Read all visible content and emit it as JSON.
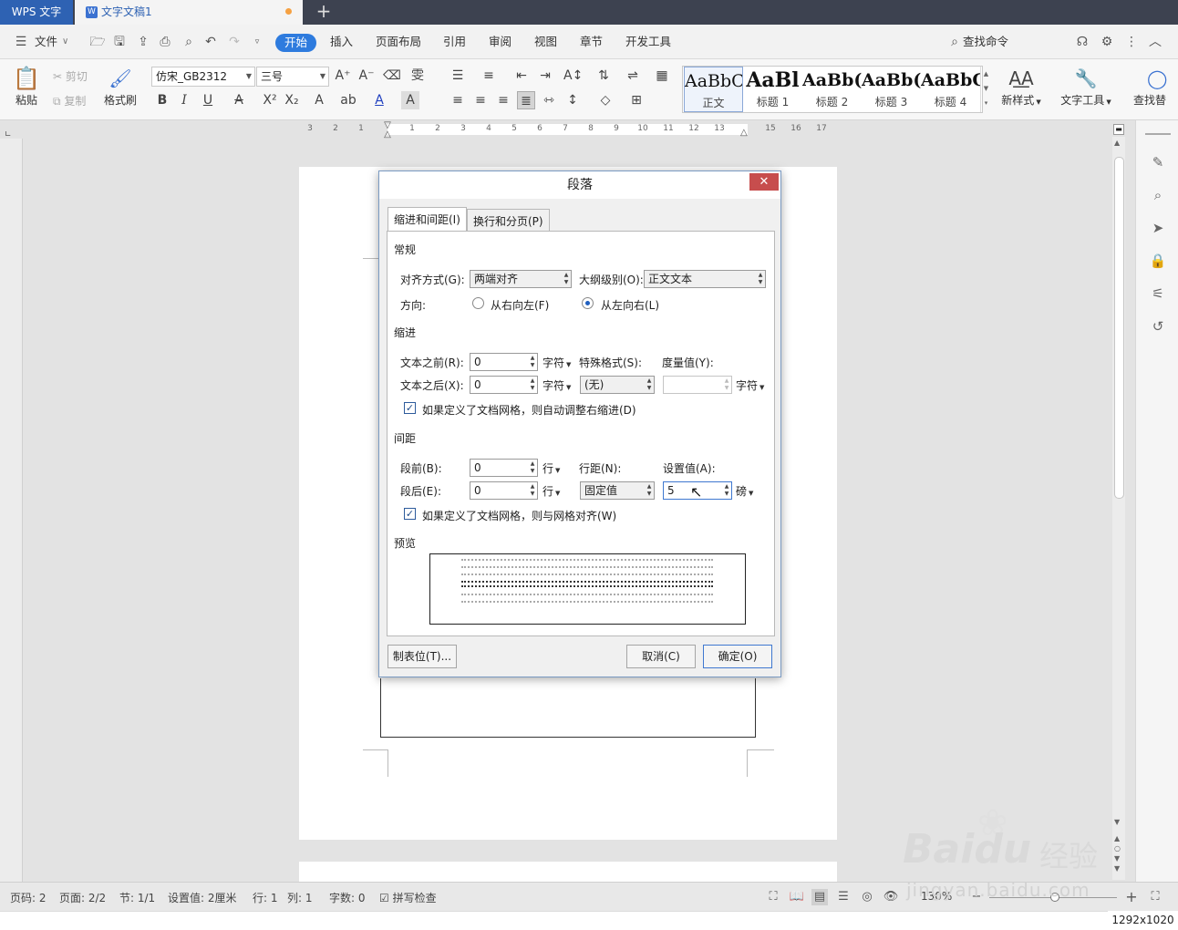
{
  "titlebar": {
    "app_tab": "WPS 文字",
    "doc_tab": "文字文稿1",
    "new_tab": "+"
  },
  "menubar": {
    "file_label": "文件",
    "items": [
      "开始",
      "插入",
      "页面布局",
      "引用",
      "审阅",
      "视图",
      "章节",
      "开发工具"
    ],
    "search": "查找命令"
  },
  "ribbon": {
    "paste": "粘贴",
    "cut": "剪切",
    "copy": "复制",
    "format_painter": "格式刷",
    "font_name": "仿宋_GB2312",
    "font_size": "三号",
    "styles": [
      {
        "sample": "AaBbC",
        "label": "正文"
      },
      {
        "sample": "AaBl",
        "label": "标题 1"
      },
      {
        "sample": "AaBb(",
        "label": "标题 2"
      },
      {
        "sample": "AaBb(",
        "label": "标题 3"
      },
      {
        "sample": "AaBbC",
        "label": "标题 4"
      }
    ],
    "new_style": "新样式",
    "text_tools": "文字工具",
    "find_replace": "查找替"
  },
  "ruler": {
    "numbers": [
      "3",
      "2",
      "1",
      "1",
      "2",
      "3",
      "4",
      "5",
      "6",
      "7",
      "8",
      "9",
      "10",
      "11",
      "12",
      "13",
      "15",
      "16",
      "17"
    ]
  },
  "dialog": {
    "title": "段落",
    "tabs": [
      "缩进和间距(I)",
      "换行和分页(P)"
    ],
    "general": {
      "heading": "常规",
      "alignment_label": "对齐方式(G):",
      "alignment_value": "两端对齐",
      "outline_label": "大纲级别(O):",
      "outline_value": "正文文本",
      "direction_label": "方向:",
      "rtl_label": "从右向左(F)",
      "ltr_label": "从左向右(L)"
    },
    "indent": {
      "heading": "缩进",
      "before_label": "文本之前(R):",
      "before_value": "0",
      "after_label": "文本之后(X):",
      "after_value": "0",
      "unit_chars": "字符",
      "special_label": "特殊格式(S):",
      "special_value": "(无)",
      "measure_label": "度量值(Y):",
      "measure_value": "",
      "auto_adjust_label": "如果定义了文档网格，则自动调整右缩进(D)"
    },
    "spacing": {
      "heading": "间距",
      "before_label": "段前(B):",
      "before_value": "0",
      "after_label": "段后(E):",
      "after_value": "0",
      "unit_lines": "行",
      "line_spacing_label": "行距(N):",
      "line_spacing_value": "固定值",
      "set_value_label": "设置值(A):",
      "set_value": "5",
      "unit_pounds": "磅",
      "grid_snap_label": "如果定义了文档网格，则与网格对齐(W)"
    },
    "preview_heading": "预览",
    "tabs_button": "制表位(T)...",
    "cancel_button": "取消(C)",
    "ok_button": "确定(O)"
  },
  "statusbar": {
    "page": "页码: 2",
    "pages": "页面: 2/2",
    "section": "节: 1/1",
    "setting": "设置值: 2厘米",
    "row": "行: 1",
    "col": "列: 1",
    "words": "字数: 0",
    "spell": "拼写检查",
    "zoom": "130%"
  },
  "watermark": {
    "brand": "Bai",
    "brand2": "du",
    "cn": "经验",
    "url": "jingyan.baidu.com"
  },
  "size_label": "1292x1020"
}
